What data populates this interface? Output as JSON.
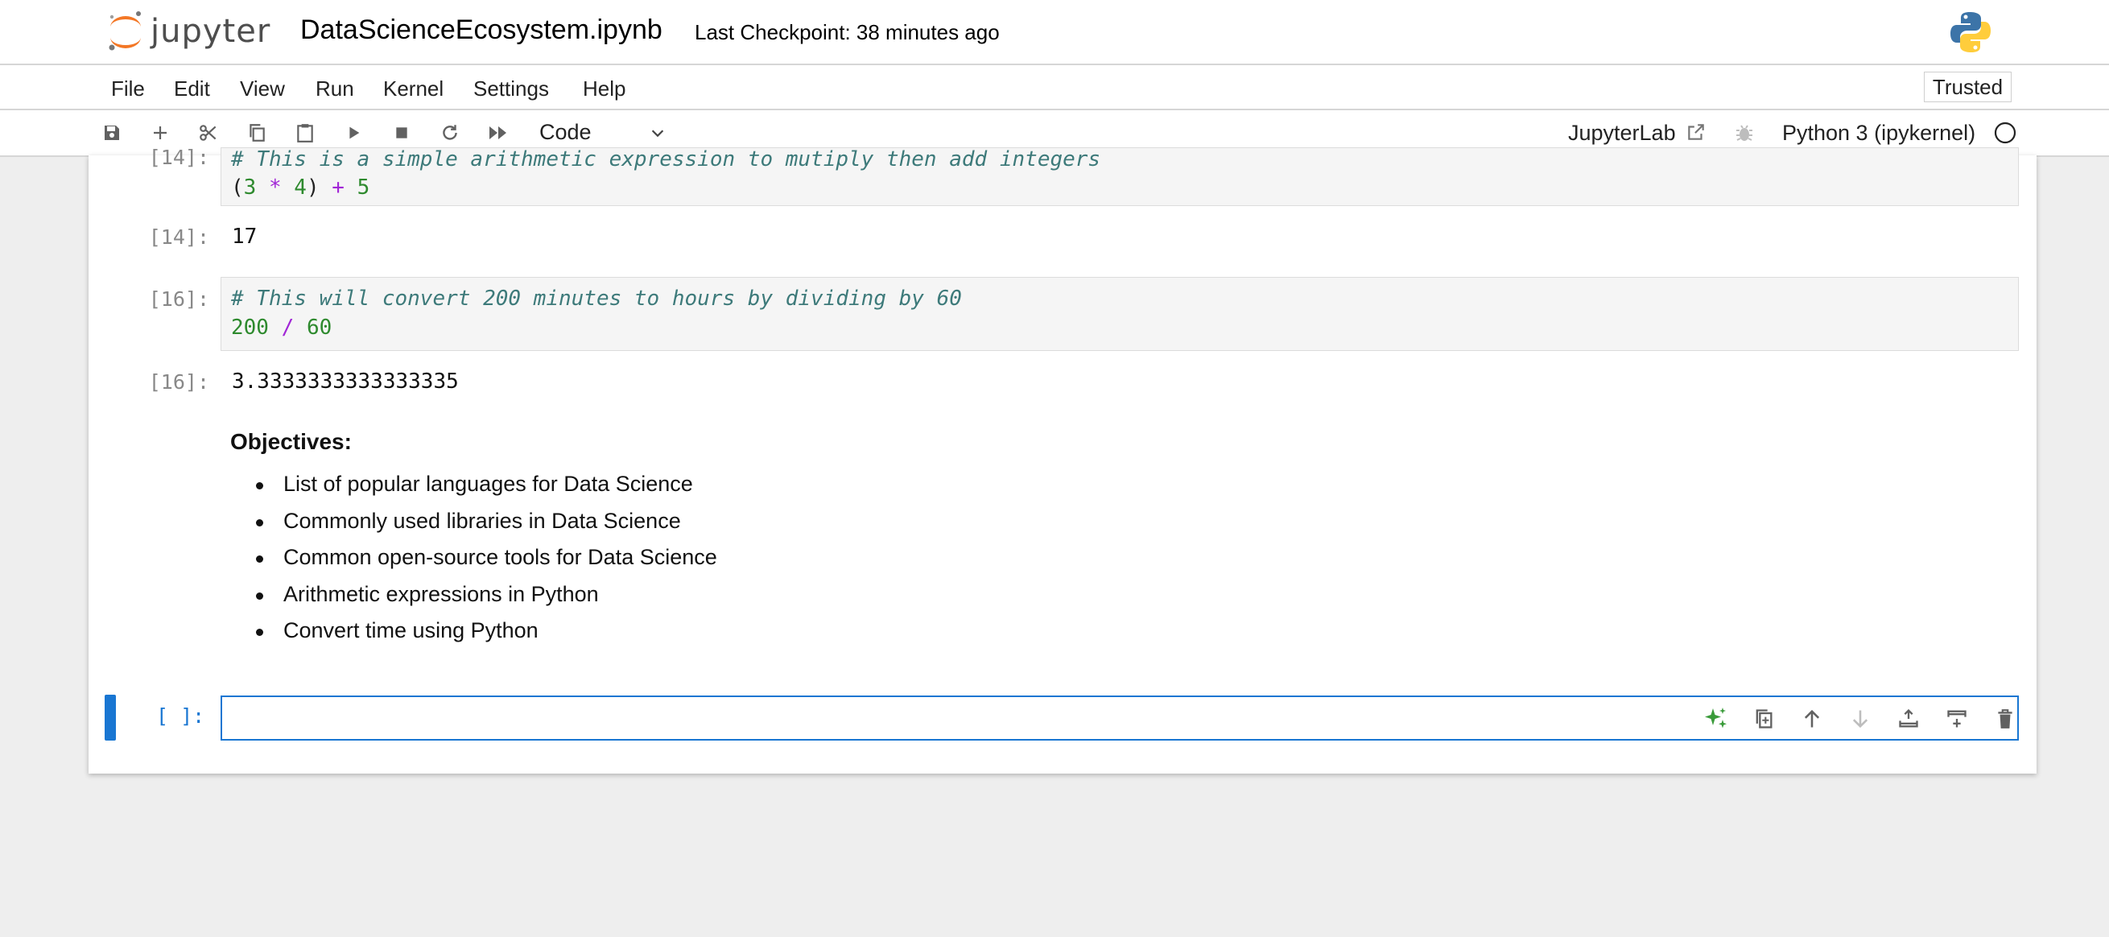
{
  "header": {
    "logo_text": "jupyter",
    "notebook_title": "DataScienceEcosystem.ipynb",
    "checkpoint": "Last Checkpoint: 38 minutes ago"
  },
  "menu": {
    "items": [
      "File",
      "Edit",
      "View",
      "Run",
      "Kernel",
      "Settings",
      "Help"
    ],
    "trusted": "Trusted"
  },
  "toolbar": {
    "cell_type": "Code",
    "jupyterlab_link": "JupyterLab",
    "kernel": "Python 3 (ipykernel)"
  },
  "cells": {
    "c1": {
      "comment": "# This is a simple arithmetic expression to mutiply then add integers",
      "prompt": "[14]:",
      "output": "17"
    },
    "c2": {
      "prompt": "[16]:",
      "comment": "# This will convert 200 minutes to hours by dividing by 60",
      "output": "3.3333333333333335"
    },
    "markdown": {
      "heading": "Objectives:",
      "items": [
        "List of popular languages for Data Science",
        "Commonly used libraries in Data Science",
        "Common open-source tools for Data Science",
        "Arithmetic expressions in Python",
        "Convert time using Python"
      ]
    },
    "active": {
      "prompt": "[ ]:"
    }
  },
  "colors": {
    "accent": "#1976d2",
    "comment": "#3d7a7a",
    "number": "#2e8a2e",
    "operator": "#a126d6"
  }
}
